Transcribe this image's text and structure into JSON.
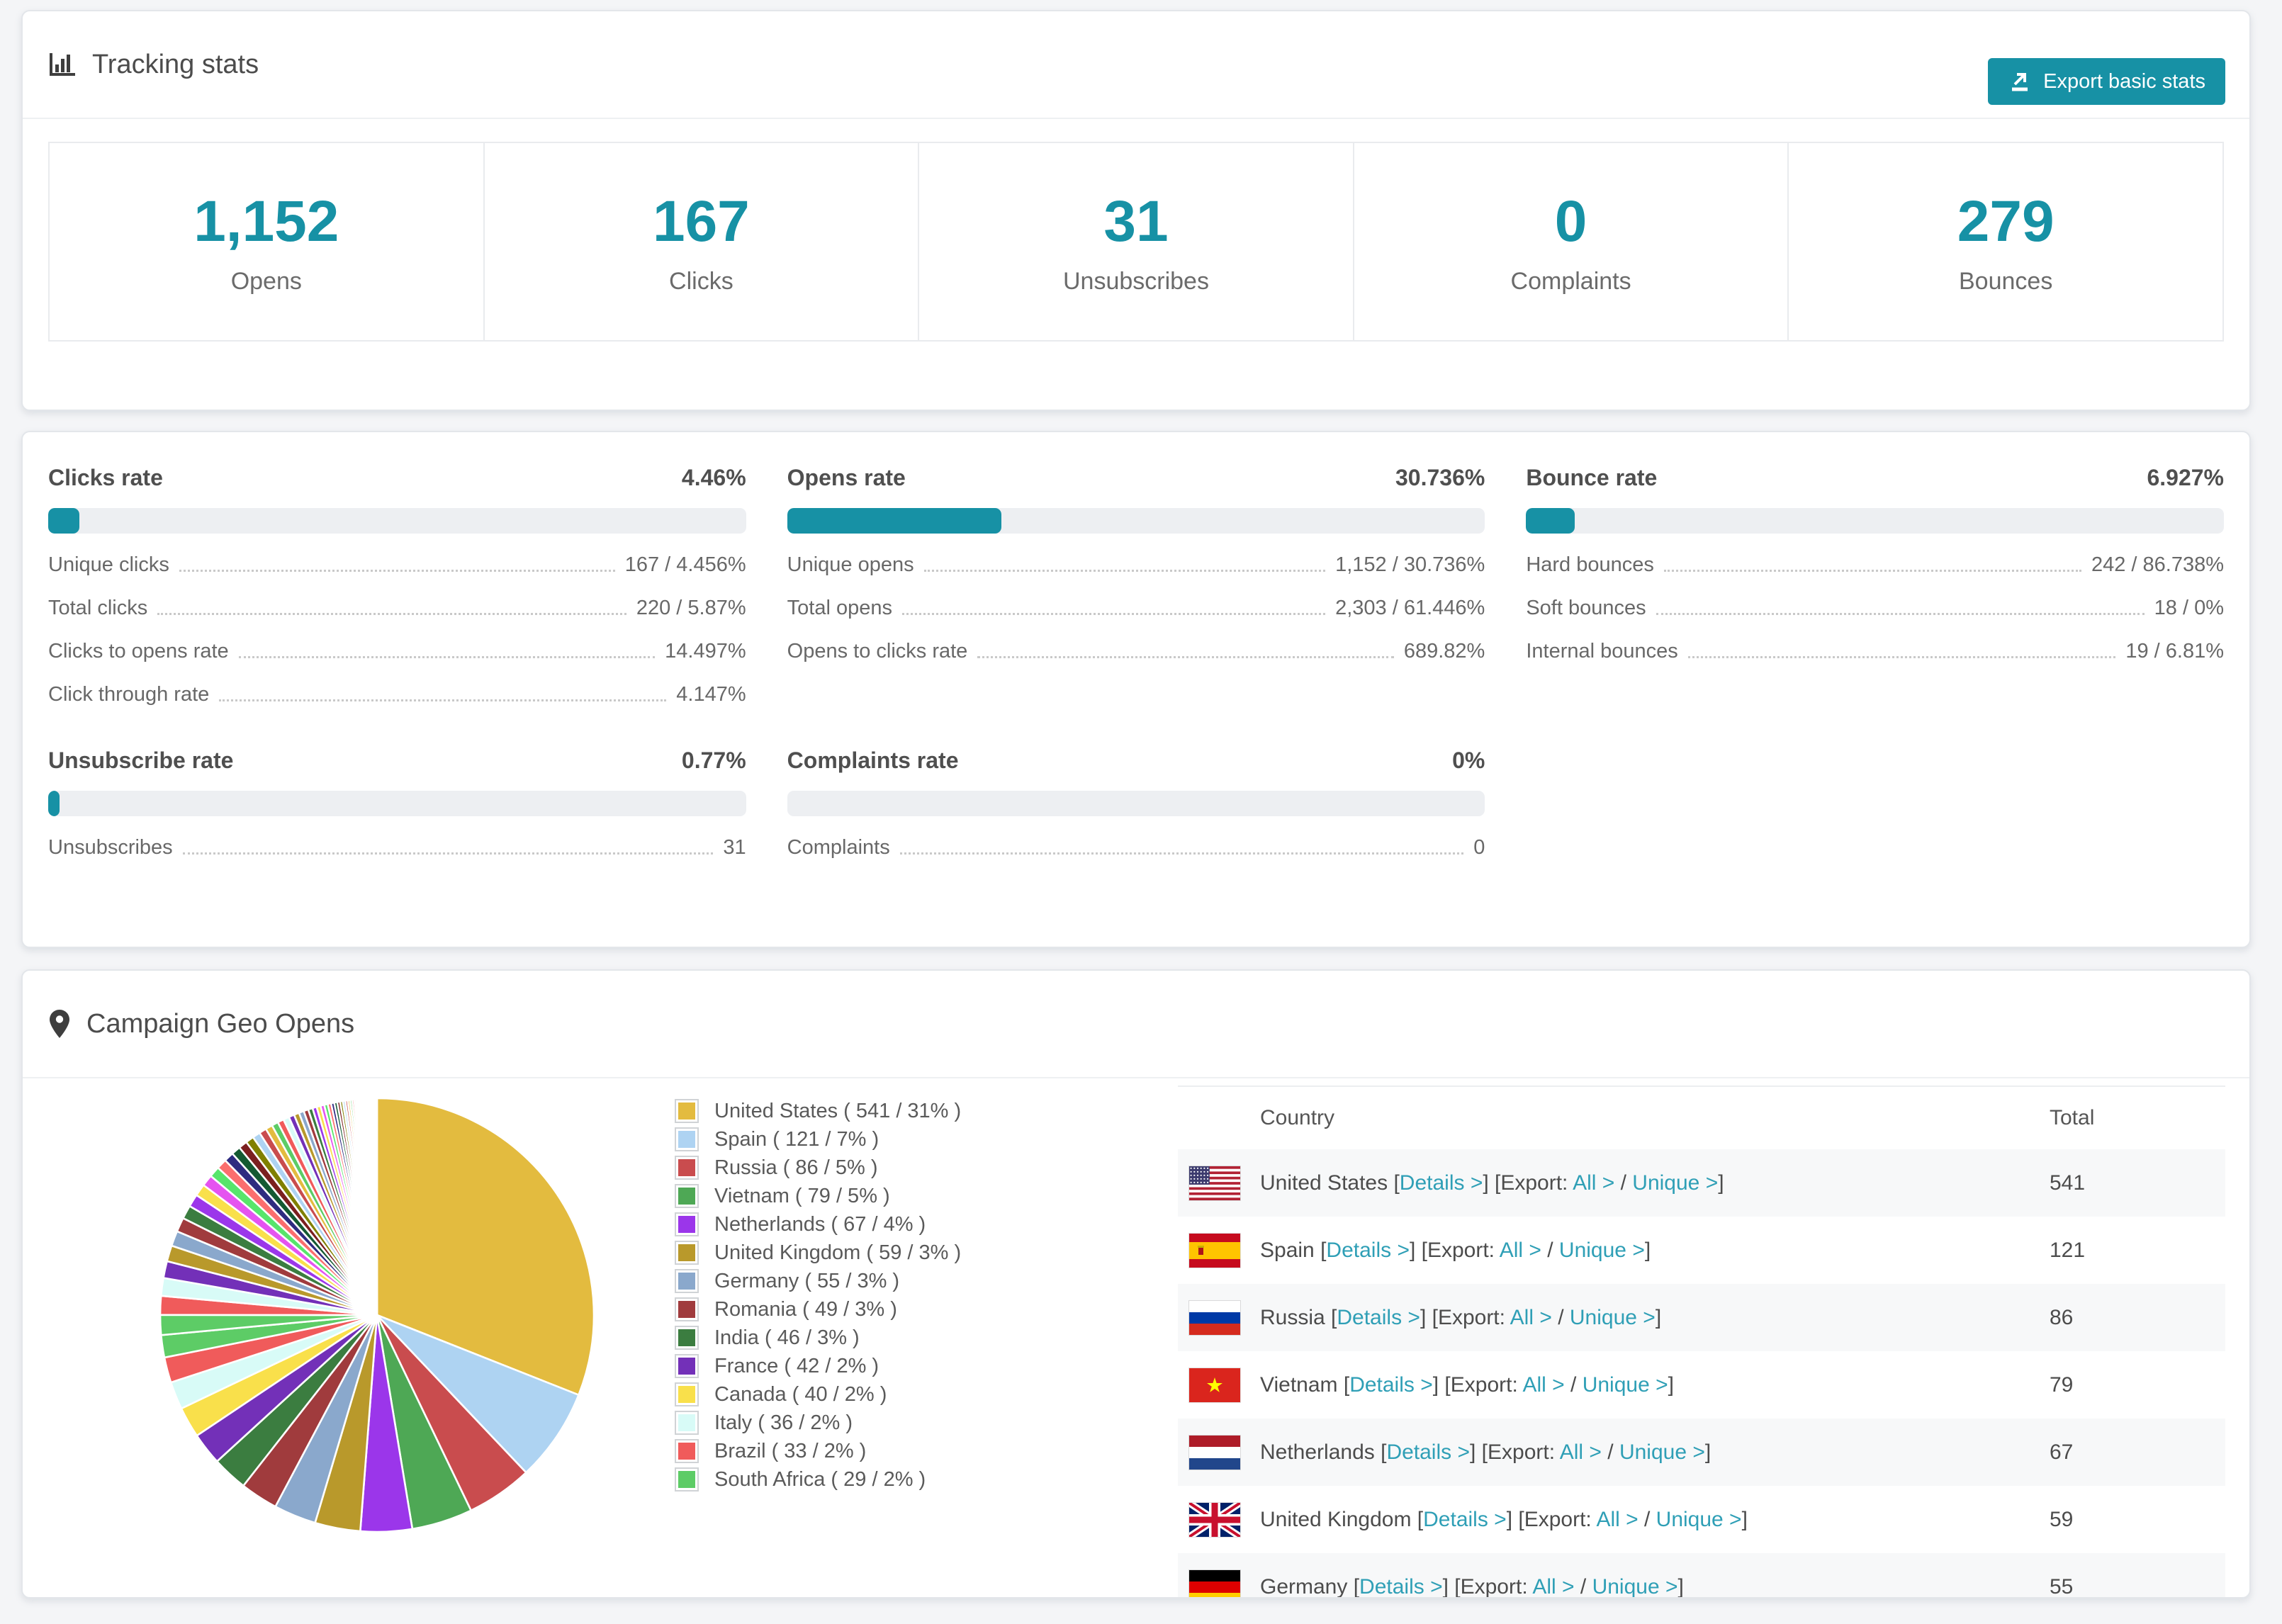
{
  "colors": {
    "accent": "#1791a5",
    "link": "#2f9fb6",
    "bar_track": "#edeff2",
    "card_border": "#e3e6ea",
    "row_stripe": "#f7f8f9",
    "page_background": "#f4f5f7"
  },
  "tracking": {
    "title": "Tracking stats",
    "export_button": "Export basic stats",
    "stats": [
      {
        "value": "1,152",
        "label": "Opens"
      },
      {
        "value": "167",
        "label": "Clicks"
      },
      {
        "value": "31",
        "label": "Unsubscribes"
      },
      {
        "value": "0",
        "label": "Complaints"
      },
      {
        "value": "279",
        "label": "Bounces"
      }
    ]
  },
  "rates": {
    "panels": [
      {
        "title": "Clicks rate",
        "value": "4.46%",
        "percent": 4.46,
        "rows": [
          {
            "label": "Unique clicks",
            "value": "167 / 4.456%"
          },
          {
            "label": "Total clicks",
            "value": "220 / 5.87%"
          },
          {
            "label": "Clicks to opens rate",
            "value": "14.497%"
          },
          {
            "label": "Click through rate",
            "value": "4.147%"
          }
        ]
      },
      {
        "title": "Opens rate",
        "value": "30.736%",
        "percent": 30.736,
        "rows": [
          {
            "label": "Unique opens",
            "value": "1,152 / 30.736%"
          },
          {
            "label": "Total opens",
            "value": "2,303 / 61.446%"
          },
          {
            "label": "Opens to clicks rate",
            "value": "689.82%"
          }
        ]
      },
      {
        "title": "Bounce rate",
        "value": "6.927%",
        "percent": 6.927,
        "rows": [
          {
            "label": "Hard bounces",
            "value": "242 / 86.738%"
          },
          {
            "label": "Soft bounces",
            "value": "18 / 0%"
          },
          {
            "label": "Internal bounces",
            "value": "19 / 6.81%"
          }
        ]
      },
      {
        "title": "Unsubscribe rate",
        "value": "0.77%",
        "percent": 0.77,
        "rows": [
          {
            "label": "Unsubscribes",
            "value": "31"
          }
        ]
      },
      {
        "title": "Complaints rate",
        "value": "0%",
        "percent": 0,
        "rows": [
          {
            "label": "Complaints",
            "value": "0"
          }
        ]
      }
    ]
  },
  "geo": {
    "title": "Campaign Geo Opens",
    "table": {
      "headers": [
        "Country",
        "Total"
      ],
      "link_text": {
        "open": "[",
        "close": "]",
        "slash": "/",
        "details": "Details >",
        "export_prefix": "[Export:",
        "all": "All >",
        "unique": "Unique >"
      },
      "rows": [
        {
          "country": "United States",
          "flag": "us",
          "total": "541"
        },
        {
          "country": "Spain",
          "flag": "es",
          "total": "121"
        },
        {
          "country": "Russia",
          "flag": "ru",
          "total": "86"
        },
        {
          "country": "Vietnam",
          "flag": "vn",
          "total": "79"
        },
        {
          "country": "Netherlands",
          "flag": "nl",
          "total": "67"
        },
        {
          "country": "United Kingdom",
          "flag": "gb",
          "total": "59"
        },
        {
          "country": "Germany",
          "flag": "de",
          "total": "55"
        }
      ]
    }
  },
  "chart_data": {
    "type": "pie",
    "title": "Campaign Geo Opens",
    "unit": "opens",
    "legend_position": "right",
    "start": "top, clockwise",
    "labels": [
      "United States",
      "Spain",
      "Russia",
      "Vietnam",
      "Netherlands",
      "United Kingdom",
      "Germany",
      "Romania",
      "India",
      "France",
      "Canada",
      "Italy",
      "Brazil",
      "South Africa",
      "Others (unlabeled small slices)"
    ],
    "values": [
      541,
      121,
      86,
      79,
      67,
      59,
      55,
      49,
      46,
      42,
      40,
      36,
      33,
      29,
      462
    ],
    "percent_labels": [
      31,
      7,
      5,
      5,
      4,
      3,
      3,
      3,
      3,
      2,
      2,
      2,
      2,
      2,
      null
    ],
    "colors": [
      "#e3bb3f",
      "#aed3f2",
      "#c94c4e",
      "#4ea855",
      "#9b36ea",
      "#b9992b",
      "#8aa8cc",
      "#a03b3d",
      "#3b7d40",
      "#7330b8",
      "#f9e04b",
      "#d8fbf7",
      "#f05b5b",
      "#5dcc66"
    ],
    "tail_palette": [
      "#5dcc66",
      "#f05b5b",
      "#d8fbf7",
      "#7330b8",
      "#b9992b",
      "#8aa8cc",
      "#a03b3d",
      "#3b7d40",
      "#9b36ea",
      "#f9e04b",
      "#e553f0",
      "#57e56b",
      "#fb6e6e",
      "#2e2b80",
      "#145a32",
      "#7b1f1f",
      "#808000",
      "#aed3f2",
      "#c94c4e",
      "#e3bb3f"
    ],
    "others_slice_count": 60
  }
}
